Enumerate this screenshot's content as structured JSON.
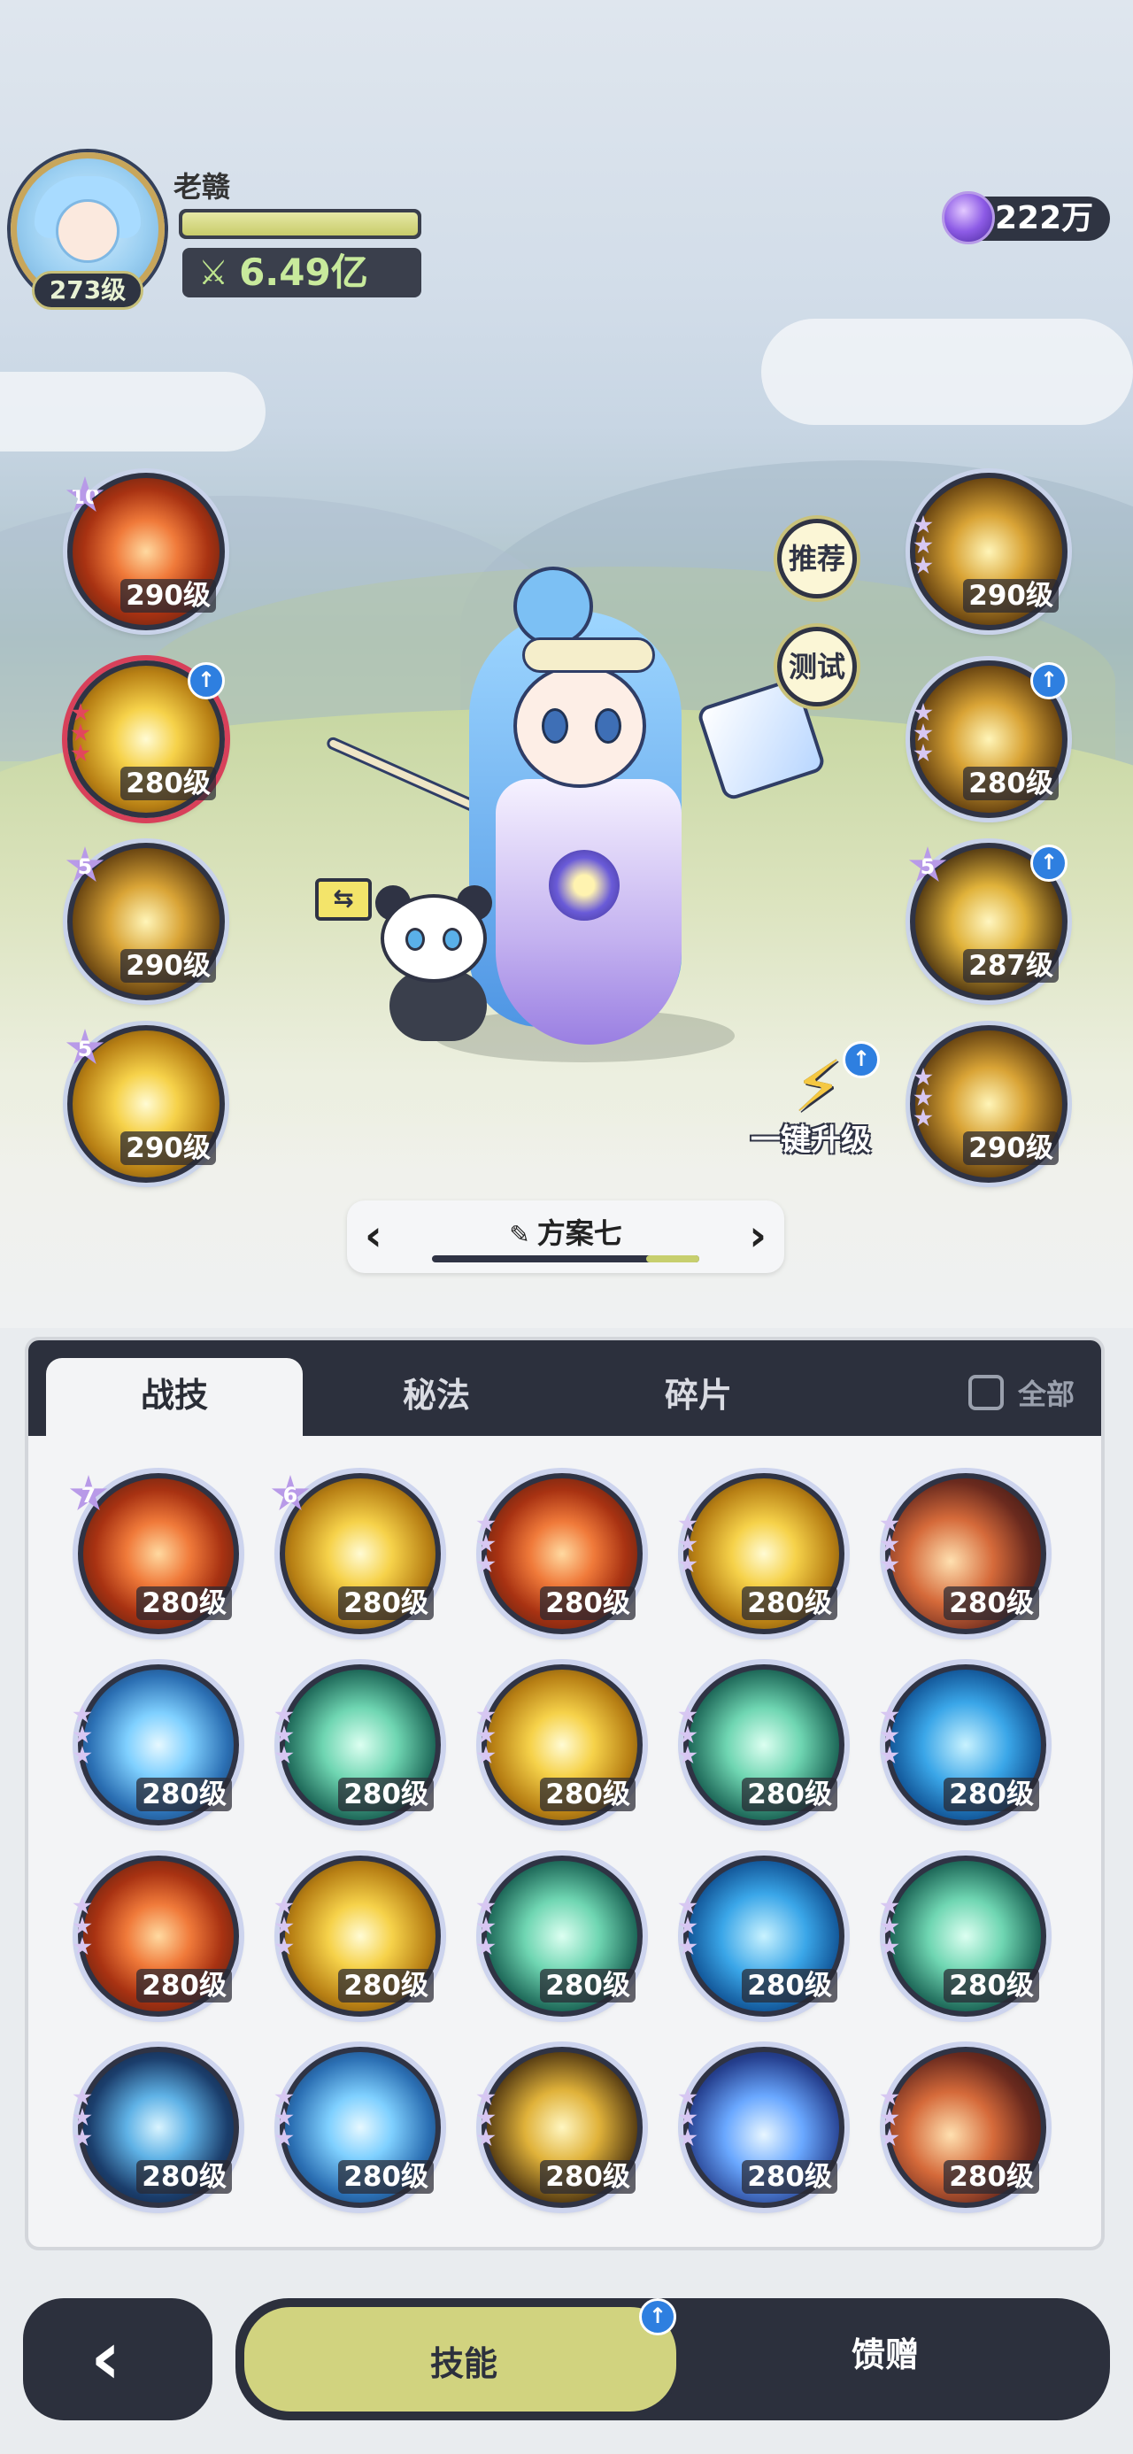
{
  "player": {
    "name": "老赣",
    "level": "273级",
    "exp_fraction": 1.0,
    "power": "6.49亿"
  },
  "currency": {
    "gems": "222万",
    "icon": "purple-gem-icon"
  },
  "equipped_left": [
    {
      "star": "10",
      "level": "290级",
      "effect": "fire",
      "upgradable": false
    },
    {
      "star": "",
      "level": "280级",
      "effect": "gold",
      "upgradable": true,
      "red": true
    },
    {
      "star": "5",
      "level": "290级",
      "effect": "goldring",
      "upgradable": false
    },
    {
      "star": "5",
      "level": "290级",
      "effect": "gold",
      "upgradable": false
    }
  ],
  "equipped_right": [
    {
      "level": "290级",
      "effect": "goldring",
      "upgradable": false
    },
    {
      "level": "280级",
      "effect": "goldring",
      "upgradable": true
    },
    {
      "star": "5",
      "level": "287级",
      "effect": "gem",
      "upgradable": true
    },
    {
      "level": "290级",
      "effect": "goldring",
      "upgradable": false
    }
  ],
  "side_buttons": {
    "recommend": "推荐",
    "test": "测试",
    "upgrade_all": "一键升级",
    "swap_icon": "swap-icon"
  },
  "preset": {
    "name": "方案七",
    "progress": 0.2
  },
  "tabs": {
    "combat": "战技",
    "secret": "秘法",
    "fragments": "碎片",
    "all": "全部"
  },
  "skills": [
    {
      "star": "7",
      "level": "280级",
      "effect": "fire"
    },
    {
      "star": "6",
      "level": "280级",
      "effect": "gold"
    },
    {
      "level": "280级",
      "effect": "fire"
    },
    {
      "level": "280级",
      "effect": "gold"
    },
    {
      "level": "280级",
      "effect": "meteor"
    },
    {
      "level": "280级",
      "effect": "ice"
    },
    {
      "level": "280级",
      "effect": "wind"
    },
    {
      "level": "280级",
      "effect": "gold"
    },
    {
      "level": "280级",
      "effect": "wind"
    },
    {
      "level": "280级",
      "effect": "swirl"
    },
    {
      "level": "280级",
      "effect": "fire"
    },
    {
      "level": "280级",
      "effect": "gold"
    },
    {
      "level": "280级",
      "effect": "wind"
    },
    {
      "level": "280级",
      "effect": "swirl"
    },
    {
      "level": "280级",
      "effect": "wind"
    },
    {
      "level": "280级",
      "effect": "dark"
    },
    {
      "level": "280级",
      "effect": "ice"
    },
    {
      "level": "280级",
      "effect": "gem"
    },
    {
      "level": "280级",
      "effect": "lotus"
    },
    {
      "level": "280级",
      "effect": "meteor"
    }
  ],
  "bottom_nav": {
    "skills": "技能",
    "gift": "馈赠",
    "back_icon": "back-arrow-icon"
  },
  "colors": {
    "accent": "#d1d37f",
    "dark": "#2c303d",
    "upgrade_blue": "#2e7fe0"
  }
}
